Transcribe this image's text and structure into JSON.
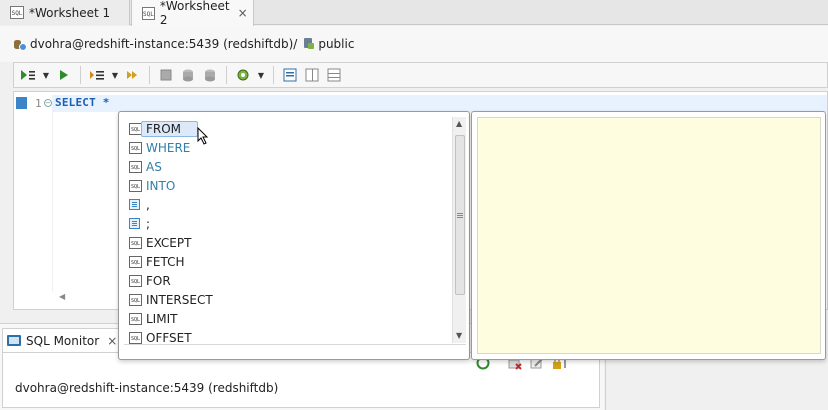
{
  "tabs": [
    {
      "label": "*Worksheet 1",
      "icon": "sql-file-icon",
      "active": false
    },
    {
      "label": "*Worksheet 2",
      "icon": "sql-file-icon",
      "active": true,
      "close": "×"
    }
  ],
  "connection": {
    "label": "dvohra@redshift-instance:5439 (redshiftdb)/",
    "schema": "public"
  },
  "editor": {
    "line_number": "1",
    "code": "SELECT *"
  },
  "completion": {
    "items": [
      {
        "label": "FROM",
        "icon": "sql-keyword-icon",
        "selected": true
      },
      {
        "label": "WHERE",
        "icon": "sql-keyword-icon",
        "color": "#2f7fa8"
      },
      {
        "label": "AS",
        "icon": "sql-keyword-icon",
        "color": "#2f7fa8"
      },
      {
        "label": "INTO",
        "icon": "sql-keyword-icon",
        "color": "#2f7fa8"
      },
      {
        "label": ",",
        "icon": "symbol-icon"
      },
      {
        "label": ";",
        "icon": "symbol-icon"
      },
      {
        "label": "EXCEPT",
        "icon": "sql-keyword-icon"
      },
      {
        "label": "FETCH",
        "icon": "sql-keyword-icon"
      },
      {
        "label": "FOR",
        "icon": "sql-keyword-icon"
      },
      {
        "label": "INTERSECT",
        "icon": "sql-keyword-icon"
      },
      {
        "label": "LIMIT",
        "icon": "sql-keyword-icon"
      },
      {
        "label": "OFFSET",
        "icon": "sql-keyword-icon"
      }
    ]
  },
  "bottom_panel": {
    "tab_label": "SQL Monitor",
    "tab_close": "×",
    "connection": "dvohra@redshift-instance:5439 (redshiftdb)"
  },
  "colors": {
    "doc_background": "#fffde0",
    "keyword_blue": "#2f7fa8",
    "code_blue": "#1a5fb4"
  }
}
